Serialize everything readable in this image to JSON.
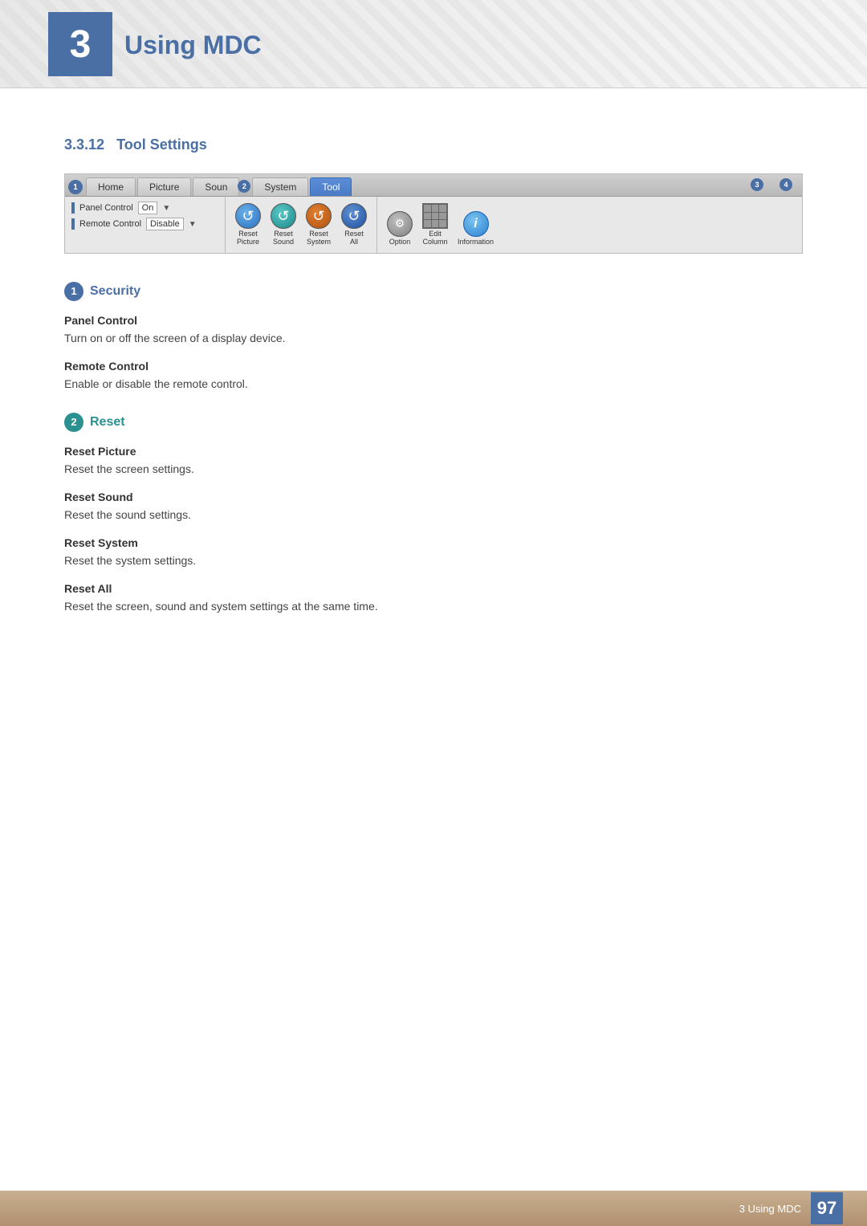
{
  "header": {
    "chapter_number": "3",
    "chapter_title": "Using MDC"
  },
  "section": {
    "number": "3.3.12",
    "title": "Tool Settings"
  },
  "toolbar": {
    "tabs": [
      {
        "id": "home",
        "label": "Home",
        "active": false
      },
      {
        "id": "picture",
        "label": "Picture",
        "active": false
      },
      {
        "id": "sound",
        "label": "Soun",
        "active": false,
        "num": "2"
      },
      {
        "id": "system",
        "label": "System",
        "active": false
      },
      {
        "id": "tool",
        "label": "Tool",
        "active": true
      }
    ],
    "panel_rows": [
      {
        "label": "Panel Control",
        "value": "On"
      },
      {
        "label": "Remote Control",
        "value": "Disable"
      }
    ],
    "icon_groups": {
      "reset_group": [
        {
          "label": "Reset\nPicture",
          "type": "blue"
        },
        {
          "label": "Reset\nSound",
          "type": "teal"
        },
        {
          "label": "Reset\nSystem",
          "type": "teal2"
        },
        {
          "label": "Reset\nAll",
          "type": "gray"
        }
      ],
      "other_group": [
        {
          "label": "Option",
          "type": "gray2"
        },
        {
          "label": "Edit\nColumn",
          "type": "grid"
        },
        {
          "label": "Information",
          "type": "info"
        }
      ]
    },
    "corner_numbers": [
      "3",
      "4"
    ]
  },
  "security_section": {
    "badge_num": "1",
    "title": "Security",
    "panel_control": {
      "term": "Panel Control",
      "desc": "Turn on or off the screen of a display device."
    },
    "remote_control": {
      "term": "Remote Control",
      "desc": "Enable or disable the remote control."
    }
  },
  "reset_section": {
    "badge_num": "2",
    "title": "Reset",
    "items": [
      {
        "term": "Reset Picture",
        "desc": "Reset the screen settings."
      },
      {
        "term": "Reset Sound",
        "desc": "Reset the sound settings."
      },
      {
        "term": "Reset System",
        "desc": "Reset the system settings."
      },
      {
        "term": "Reset All",
        "desc": "Reset the screen, sound and system settings at the same time."
      }
    ]
  },
  "footer": {
    "text": "3 Using MDC",
    "page": "97"
  }
}
